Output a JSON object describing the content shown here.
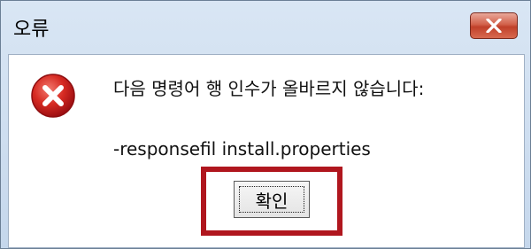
{
  "dialog": {
    "title": "오류",
    "message": "다음 명령어 행 인수가 올바르지 않습니다:",
    "detail": "-responsefil install.properties",
    "ok_label": "확인"
  },
  "icons": {
    "close": "close-icon",
    "error": "error-icon"
  },
  "colors": {
    "close_button": "#c0402a",
    "error_icon": "#c8171e",
    "highlight_box": "#b0161e"
  }
}
